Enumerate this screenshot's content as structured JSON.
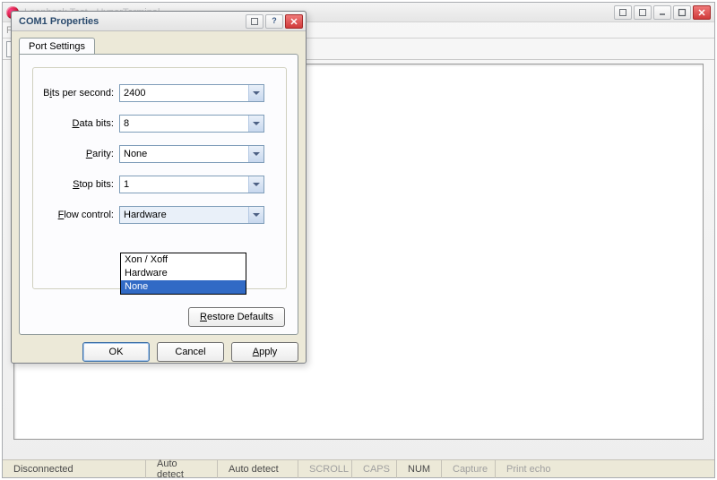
{
  "parent": {
    "title": "Loopback Test - HyperTerminal"
  },
  "dialog": {
    "title": "COM1 Properties",
    "tab_label": "Port Settings",
    "fields": {
      "bps": {
        "label_pre": "B",
        "label_u": "i",
        "label_post": "ts per second:",
        "value": "2400"
      },
      "data": {
        "label_pre": "",
        "label_u": "D",
        "label_post": "ata bits:",
        "value": "8"
      },
      "parity": {
        "label_pre": "",
        "label_u": "P",
        "label_post": "arity:",
        "value": "None"
      },
      "stop": {
        "label_pre": "",
        "label_u": "S",
        "label_post": "top bits:",
        "value": "1"
      },
      "flow": {
        "label_pre": "",
        "label_u": "F",
        "label_post": "low control:",
        "value": "Hardware"
      }
    },
    "flow_options": {
      "opt0": "Xon / Xoff",
      "opt1": "Hardware",
      "opt2": "None"
    },
    "restore_pre": "",
    "restore_u": "R",
    "restore_post": "estore Defaults",
    "ok": "OK",
    "cancel": "Cancel",
    "apply_u": "A",
    "apply_post": "pply"
  },
  "status": {
    "s0": "Disconnected",
    "s1": "Auto detect",
    "s2": "Auto detect",
    "s3": "SCROLL",
    "s4": "CAPS",
    "s5": "NUM",
    "s6": "Capture",
    "s7": "Print echo"
  }
}
